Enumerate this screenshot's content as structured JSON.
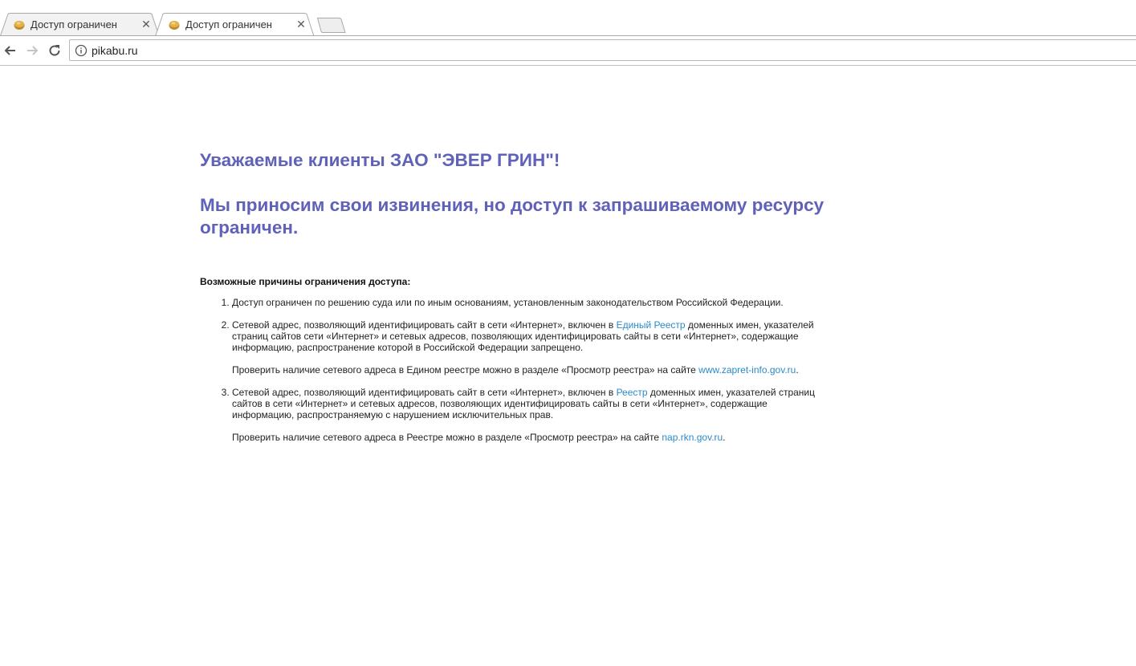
{
  "browser": {
    "tabs": [
      {
        "title": "Доступ ограничен",
        "close": "✕",
        "active": false
      },
      {
        "title": "Доступ ограничен",
        "close": "✕",
        "active": true
      }
    ],
    "address": "pikabu.ru"
  },
  "page": {
    "heading1": "Уважаемые клиенты ЗАО \"ЭВЕР ГРИН\"!",
    "heading2": "Мы приносим свои извинения, но доступ к запрашиваемому ресурсу ограничен.",
    "reasons_title": "Возможные причины ограничения доступа:",
    "reasons": [
      {
        "text": "Доступ ограничен  по решению суда или по иным основаниям, установленным законодательством Российской Федерации."
      },
      {
        "text_before": "Сетевой адрес, позволяющий идентифицировать сайт в сети «Интернет», включен в ",
        "link": "Единый Реестр",
        "text_after": " доменных имен, указателей страниц сайтов сети «Интернет» и сетевых адресов, позволяющих идентифицировать сайты в сети «Интернет», содержащие информацию, распространение которой в Российской Федерации запрещено.",
        "check_before": "Проверить наличие сетевого адреса в Едином реестре можно в разделе «Просмотр реестра» на сайте ",
        "check_link": "www.zapret-info.gov.ru",
        "check_after": "."
      },
      {
        "text_before": "Сетевой адрес, позволяющий идентифицировать сайт в сети «Интернет», включен в ",
        "link": "Реестр",
        "text_after": " доменных имен, указателей страниц сайтов в сети «Интернет» и сетевых адресов, позволяющих идентифицировать сайты в сети «Интернет», содержащие информацию, распространяемую с нарушением исключительных прав.",
        "check_before": "Проверить наличие сетевого адреса в Реестре можно в разделе «Просмотр реестра» на сайте ",
        "check_link": "nap.rkn.gov.ru",
        "check_after": "."
      }
    ]
  },
  "colors": {
    "heading": "#6061b8",
    "link": "#2a8ac9"
  },
  "icons": {
    "favicon": "cookie-favicon-icon",
    "back": "arrow-left-icon",
    "forward": "arrow-right-icon",
    "reload": "reload-icon",
    "info": "info-circle-icon",
    "new_tab": "new-tab-icon"
  }
}
